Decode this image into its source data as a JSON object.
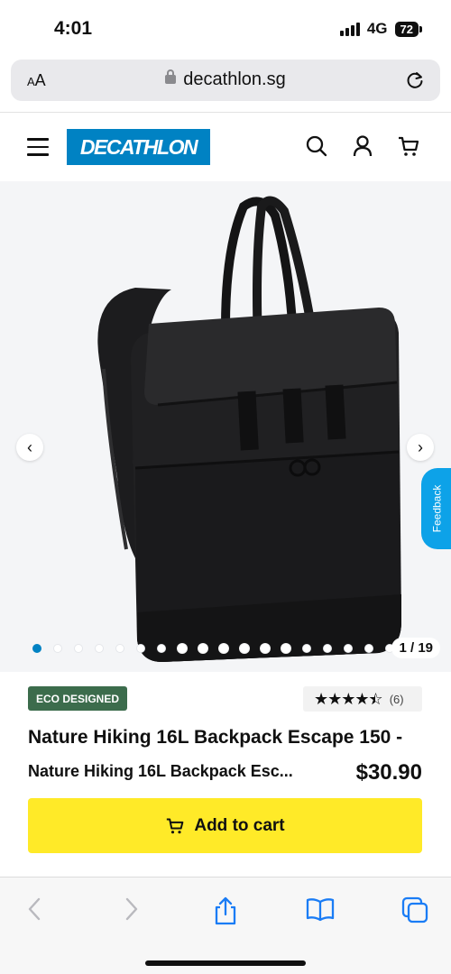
{
  "status_bar": {
    "time": "4:01",
    "network": "4G",
    "battery": "72"
  },
  "browser": {
    "text_size_label": "AA",
    "domain": "decathlon.sg"
  },
  "header": {
    "logo_text": "DECATHLON"
  },
  "gallery": {
    "counter": "1 / 19",
    "feedback_label": "Feedback",
    "dot_count": 19,
    "active_index": 0
  },
  "product": {
    "badge": "ECO DESIGNED",
    "rating_count": "(6)",
    "rating_value": 4.5,
    "title": "Nature Hiking 16L Backpack Escape 150 -",
    "subtitle": "Nature Hiking 16L Backpack Esc...",
    "price": "$30.90",
    "add_to_cart_label": "Add to cart"
  },
  "colors": {
    "brand": "#0082c3",
    "cta": "#ffea28",
    "eco_badge": "#3c6c4c",
    "feedback": "#0da2e8"
  }
}
